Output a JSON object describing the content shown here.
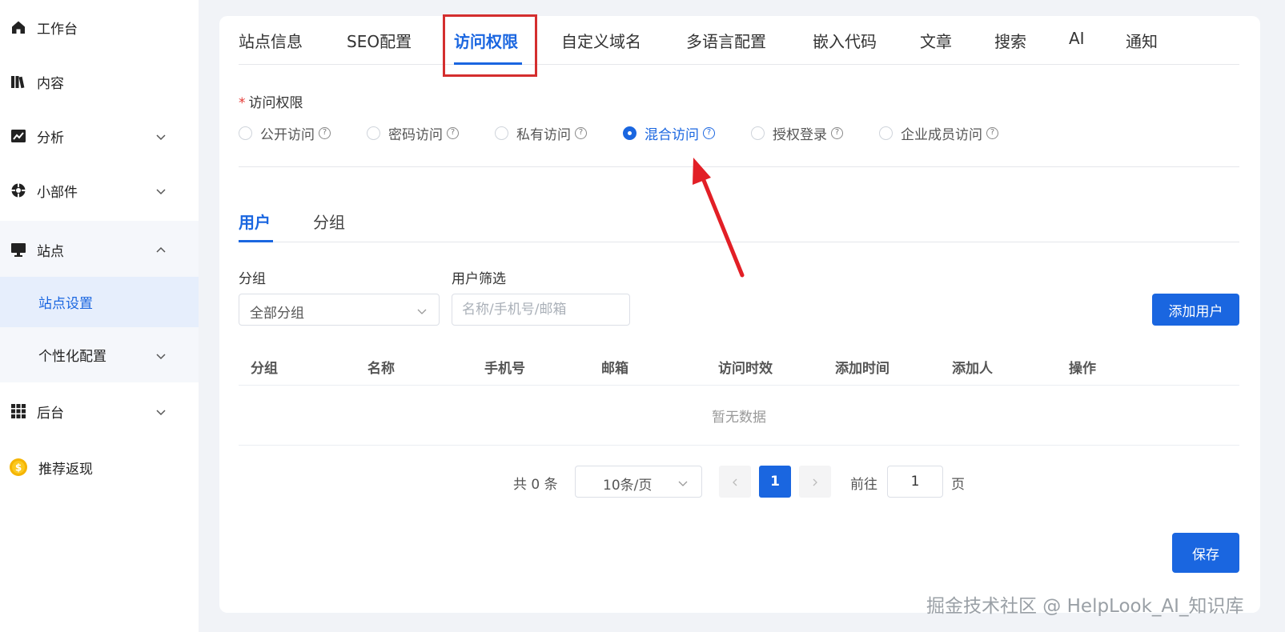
{
  "sidebar": {
    "items": [
      {
        "label": "工作台",
        "icon": "home-icon"
      },
      {
        "label": "内容",
        "icon": "books-icon"
      },
      {
        "label": "分析",
        "icon": "trend-chart-icon"
      },
      {
        "label": "小部件",
        "icon": "widget-icon"
      },
      {
        "label": "站点",
        "icon": "monitor-icon"
      },
      {
        "label": "后台",
        "icon": "grid-icon"
      },
      {
        "label": "推荐返现",
        "icon": "coin-icon"
      }
    ],
    "subitems": [
      {
        "label": "站点设置"
      },
      {
        "label": "个性化配置"
      }
    ]
  },
  "tabs": [
    "站点信息",
    "SEO配置",
    "访问权限",
    "自定义域名",
    "多语言配置",
    "嵌入代码",
    "文章",
    "搜索",
    "AI",
    "通知"
  ],
  "access": {
    "required_mark": "*",
    "label": "访问权限",
    "options": [
      "公开访问",
      "密码访问",
      "私有访问",
      "混合访问",
      "授权登录",
      "企业成员访问"
    ],
    "selected": "混合访问",
    "help_glyph": "?"
  },
  "subtabs": [
    "用户",
    "分组"
  ],
  "filters": {
    "group_label": "分组",
    "group_value": "全部分组",
    "user_label": "用户筛选",
    "user_placeholder": "名称/手机号/邮箱"
  },
  "add_user_label": "添加用户",
  "table": {
    "columns": [
      "分组",
      "名称",
      "手机号",
      "邮箱",
      "访问时效",
      "添加时间",
      "添加人",
      "操作"
    ],
    "empty_text": "暂无数据"
  },
  "pagination": {
    "total_text": "共 0 条",
    "page_size": "10条/页",
    "current_page": "1",
    "goto_label": "前往",
    "goto_value": "1",
    "page_suffix": "页"
  },
  "save_label": "保存",
  "watermark": "掘金技术社区 @ HelpLook_AI_知识库",
  "colors": {
    "accent": "#1a66e0",
    "annotation": "#d42e2e"
  }
}
